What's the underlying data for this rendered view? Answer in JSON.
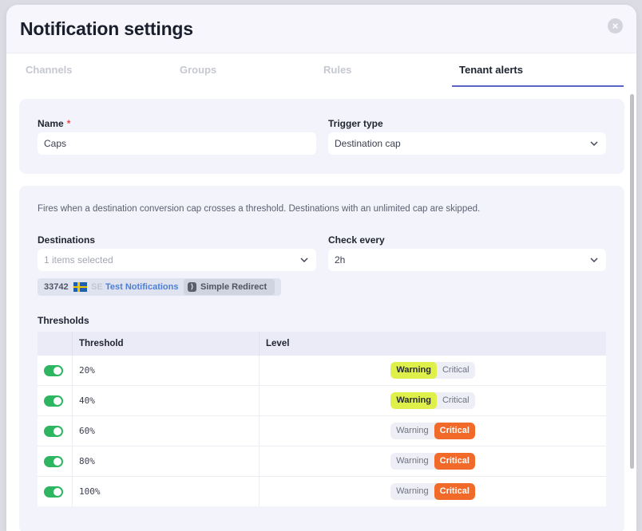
{
  "dialog": {
    "title": "Notification settings",
    "close_icon": "close-icon"
  },
  "tabs": [
    {
      "label": "Channels",
      "active": false
    },
    {
      "label": "Groups",
      "active": false
    },
    {
      "label": "Rules",
      "active": false
    },
    {
      "label": "Tenant alerts",
      "active": true
    }
  ],
  "form": {
    "name_label": "Name",
    "required_mark": "*",
    "name_value": "Caps",
    "trigger_label": "Trigger type",
    "trigger_value": "Destination cap"
  },
  "details": {
    "description": "Fires when a destination conversion cap crosses a threshold. Destinations with an unlimited cap are skipped.",
    "destinations_label": "Destinations",
    "destinations_placeholder": "1 items selected",
    "check_label": "Check every",
    "check_value": "2h",
    "selected_destination": {
      "id": "33742",
      "country": "SE",
      "name": "Test Notifications",
      "tag_icon": "redirect-icon",
      "tag": "Simple Redirect"
    }
  },
  "thresholds": {
    "section_label": "Thresholds",
    "columns": [
      "",
      "Threshold",
      "Level"
    ],
    "level_options": [
      "Warning",
      "Critical"
    ],
    "rows": [
      {
        "enabled": true,
        "threshold": "20%",
        "level": "Warning"
      },
      {
        "enabled": true,
        "threshold": "40%",
        "level": "Warning"
      },
      {
        "enabled": true,
        "threshold": "60%",
        "level": "Critical"
      },
      {
        "enabled": true,
        "threshold": "80%",
        "level": "Critical"
      },
      {
        "enabled": true,
        "threshold": "100%",
        "level": "Critical"
      }
    ]
  },
  "colors": {
    "accent": "#5a63c8",
    "toggle_on": "#2db561",
    "warning": "#dff04b",
    "critical": "#f26a2a"
  }
}
